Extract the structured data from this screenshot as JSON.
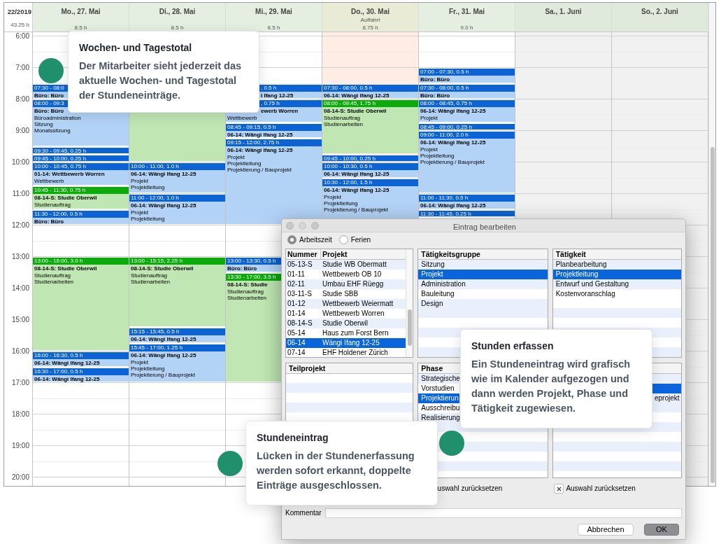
{
  "week": {
    "label": "22/2019",
    "total": "43.25 h"
  },
  "hours": [
    "6:00",
    "7:00",
    "8:00",
    "9:00",
    "10:00",
    "11:00",
    "12:00",
    "13:00",
    "14:00",
    "15:00",
    "16:00",
    "17:00",
    "18:00",
    "19:00",
    "20:00"
  ],
  "days": [
    {
      "name": "Mo., 27. Mai",
      "total": "8.5 h",
      "kind": "workday",
      "events": [
        {
          "kind": "project",
          "time": "07:30 - 08:0",
          "title": "Büro: Büro"
        },
        {
          "kind": "project",
          "time": "08:00 - 09:3",
          "title": "Büro: Büro",
          "lines": [
            "Büroadministration",
            "Sitzung",
            "Monatssitzung"
          ]
        },
        {
          "kind": "project",
          "time": "09:30 - 09:45, 0.25 h"
        },
        {
          "kind": "project",
          "time": "09:45 - 10:00, 0.25 h"
        },
        {
          "kind": "project",
          "time": "10:00 - 10:45, 0.75 h",
          "title": "01-14: Wettbewerb Worren",
          "lines": [
            "Wettbewerb"
          ]
        },
        {
          "kind": "study",
          "time": "10:45 - 11:30, 0.75 h",
          "title": "08-14-S: Studie Oberwil",
          "lines": [
            "Studienauftrag"
          ]
        },
        {
          "kind": "project",
          "time": "11:30 - 12:00, 0.5 h",
          "title": "Büro: Büro"
        },
        {
          "kind": "study",
          "time": "13:00 - 16:00, 3.0 h",
          "title": "08-14-S: Studie Oberwil",
          "lines": [
            "Studienauftrag",
            "Studienarbeiten"
          ]
        },
        {
          "kind": "project",
          "time": "16:00 - 16:30, 0.5 h",
          "title": "06-14: Wängi Ifang 12-25"
        },
        {
          "kind": "project",
          "time": "16:30 - 17:00, 0.5 h",
          "title": "06-14: Wängi Ifang 12-25"
        }
      ]
    },
    {
      "name": "Di., 28. Mai",
      "total": "8.5 h",
      "kind": "workday",
      "events": [
        {
          "kind": "study"
        },
        {
          "kind": "project",
          "time": "10:00 - 11:00, 1.0 h",
          "title": "06-14: Wängi Ifang 12-25",
          "lines": [
            "Projekt",
            "Projektleitung"
          ]
        },
        {
          "kind": "project",
          "time": "11:00 - 12:00, 1.0 h",
          "title": "06-14: Wängi Ifang 12-25",
          "lines": [
            "Projekt",
            "Projektleitung"
          ]
        },
        {
          "kind": "study",
          "time": "13:00 - 15:15, 2.25 h",
          "title": "08-14-S: Studie Oberwil",
          "lines": [
            "Studienauftrag",
            "Studienarbeiten"
          ]
        },
        {
          "kind": "project",
          "time": "15:15 - 15:45, 0.5 h",
          "title": "06-14: Wängi Ifang 12-25"
        },
        {
          "kind": "project",
          "time": "15:45 - 17:00, 1.25 h",
          "title": "06-14: Wängi Ifang 12-25",
          "lines": [
            "Projekt",
            "Projektleitung",
            "Projektierung / Bauprojekt"
          ]
        }
      ]
    },
    {
      "name": "Mi., 29. Mai",
      "total": "8.5 h",
      "kind": "workday",
      "events": [
        {
          "kind": "project",
          "time": ", 0.5 h",
          "title": "i Ifang 12-25",
          "covered": true
        },
        {
          "kind": "project",
          "time": ", 0.75 h",
          "title": "ewerb Worren",
          "lines": [
            "Wettbewerb"
          ],
          "covered": true
        },
        {
          "kind": "project",
          "time": "08:45 - 09:15, 0.5 h",
          "title": "06-14: Wängi Ifang 12-25"
        },
        {
          "kind": "project",
          "time": "09:15 - 12:00, 2.75 h",
          "title": "06-14: Wängi Ifang 12-25",
          "lines": [
            "Projekt",
            "Projektleitung",
            "Projektierung / Bauprojekt"
          ]
        },
        {
          "kind": "project",
          "time": "13:00 - 13:30, 0.5 h",
          "title": "Büro: Büro"
        },
        {
          "kind": "study",
          "time": "13:30 - 17:00, 3.5 h",
          "title": "08-14-S: Studie",
          "lines": [
            "Studienauftrag",
            "Studienarbeiten"
          ]
        }
      ]
    },
    {
      "name": "Do., 30. Mai",
      "note": "Auffahrt",
      "total": "8.75 h",
      "kind": "holiday",
      "events": [
        {
          "kind": "project",
          "time": "07:30 - 08:00, 0.5 h",
          "title": "06-14: Wängi Ifang 12-25"
        },
        {
          "kind": "study",
          "time": "08:00 - 09:45, 1.75 h",
          "title": "08-14-S: Studie Oberwil",
          "lines": [
            "Studienauftrag",
            "Studienarbeiten"
          ]
        },
        {
          "kind": "project",
          "time": "09:45 - 10:00, 0.25 h"
        },
        {
          "kind": "project",
          "time": "10:00 - 10:30, 0.5 h",
          "title": "06-14: Wängi Ifang 12-25"
        },
        {
          "kind": "project",
          "time": "10:30 - 12:00, 1.5 h",
          "title": "06-14: Wängi Ifang 12-25",
          "lines": [
            "Projekt",
            "Projektleitung",
            "Projektierung / Bauprojekt"
          ]
        }
      ]
    },
    {
      "name": "Fr., 31. Mai",
      "total": "9.0 h",
      "kind": "workday",
      "events": [
        {
          "kind": "project",
          "time": "07:00 - 07:30, 0.5 h",
          "title": "Büro: Büro"
        },
        {
          "kind": "project",
          "time": "07:30 - 08:00, 0.5 h",
          "title": "Büro: Büro"
        },
        {
          "kind": "project",
          "time": "08:00 - 08:45, 0.75 h",
          "title": "06-14: Wängi Ifang 12-25",
          "lines": [
            "Projekt"
          ]
        },
        {
          "kind": "project",
          "time": "08:45 - 09:00, 0.25 h"
        },
        {
          "kind": "project",
          "time": "09:00 - 11:00, 2.0 h",
          "title": "06-14: Wängi Ifang 12-25",
          "lines": [
            "Projekt",
            "Projektleitung",
            "Projektierung / Bauprojekt"
          ]
        },
        {
          "kind": "project",
          "time": "11:00 - 11:30, 0.5 h",
          "title": "06-14: Wängi Ifang 12-25"
        },
        {
          "kind": "project",
          "time": "11:30 - 11:45, 0.25 h"
        }
      ]
    },
    {
      "name": "Sa., 1. Juni",
      "kind": "weekend"
    },
    {
      "name": "So., 2. Juni",
      "kind": "weekend"
    }
  ],
  "dialog": {
    "title": "Eintrag bearbeiten",
    "modes": [
      {
        "label": "Arbeitszeit",
        "selected": true
      },
      {
        "label": "Ferien",
        "selected": false
      }
    ],
    "projects": {
      "columns": [
        "Nummer",
        "Projekt"
      ],
      "rows": [
        {
          "number": "05-13-S",
          "name": "Studie WB Obermatt",
          "selected": false
        },
        {
          "number": "01-11",
          "name": "Wettbewerb OB 10",
          "selected": false
        },
        {
          "number": "02-11",
          "name": "Umbau EHF Rüegg",
          "selected": false
        },
        {
          "number": "03-11-S",
          "name": "Studie SBB",
          "selected": false
        },
        {
          "number": "01-12",
          "name": "Wettbewerb Weiermatt",
          "selected": false
        },
        {
          "number": "01-14",
          "name": "Wettbewerb Worren",
          "selected": false
        },
        {
          "number": "08-14-S",
          "name": "Studie Oberwil",
          "selected": false
        },
        {
          "number": "05-14",
          "name": "Haus zum Forst Bern",
          "selected": false
        },
        {
          "number": "06-14",
          "name": "Wängi Ifang 12-25",
          "selected": true
        },
        {
          "number": "07-14",
          "name": "EHF Holdener Zürich",
          "selected": false
        }
      ]
    },
    "groups": {
      "title": "Tätigkeitsgruppe",
      "items": [
        {
          "label": "Sitzung",
          "selected": false
        },
        {
          "label": "Projekt",
          "selected": true
        },
        {
          "label": "Administration",
          "selected": false
        },
        {
          "label": "Bauleitung",
          "selected": false
        },
        {
          "label": "Design",
          "selected": false
        }
      ]
    },
    "activities": {
      "title": "Tätigkeit",
      "items": [
        {
          "label": "Planbearbeitung",
          "selected": false
        },
        {
          "label": "Projektleitung",
          "selected": true
        },
        {
          "label": "Entwurf und Gestaltung",
          "selected": false
        },
        {
          "label": "Kostenvoranschlag",
          "selected": false
        }
      ]
    },
    "subprojects": {
      "title": "Teilprojekt"
    },
    "phases": {
      "title": "Phase",
      "items": [
        {
          "label": "Strategische",
          "selected": false
        },
        {
          "label": "Vorstudien",
          "selected": false
        },
        {
          "label": "Projektierun",
          "selected": true
        },
        {
          "label": "Ausschreibu",
          "selected": false
        },
        {
          "label": "Realisierung",
          "selected": false
        }
      ]
    },
    "phase_details": {
      "items": [
        {
          "selected": false
        },
        {
          "selected": true
        },
        {
          "label": "eprojekt",
          "selected": false
        }
      ]
    },
    "resets": [
      {
        "label": "uswahl zurücksetzen",
        "kind": "plain"
      },
      {
        "label": "Auswahl zurücksetzen",
        "kind": "with-icon"
      }
    ],
    "comment": {
      "label": "Kommentar"
    },
    "buttons": [
      {
        "label": "Abbrechen",
        "kind": "secondary"
      },
      {
        "label": "OK",
        "kind": "primary"
      }
    ]
  },
  "tooltips": [
    {
      "title": "Wochen- und Tagestotal",
      "text": "Der Mitarbeiter sieht jederzeit das aktuelle Wochen- und Tagestotal der Stundeneinträge."
    },
    {
      "title": "Stunden erfassen",
      "text": "Ein Stundeneintrag wird grafisch wie im Kalender aufgezogen und dann werden Projekt, Phase und Tätigkeit zugewiesen."
    },
    {
      "title": "Stundeneintrag",
      "text": "Lücken in der Stundenerfassung werden sofort erkannt, doppelte Einträge ausgeschlossen."
    }
  ]
}
